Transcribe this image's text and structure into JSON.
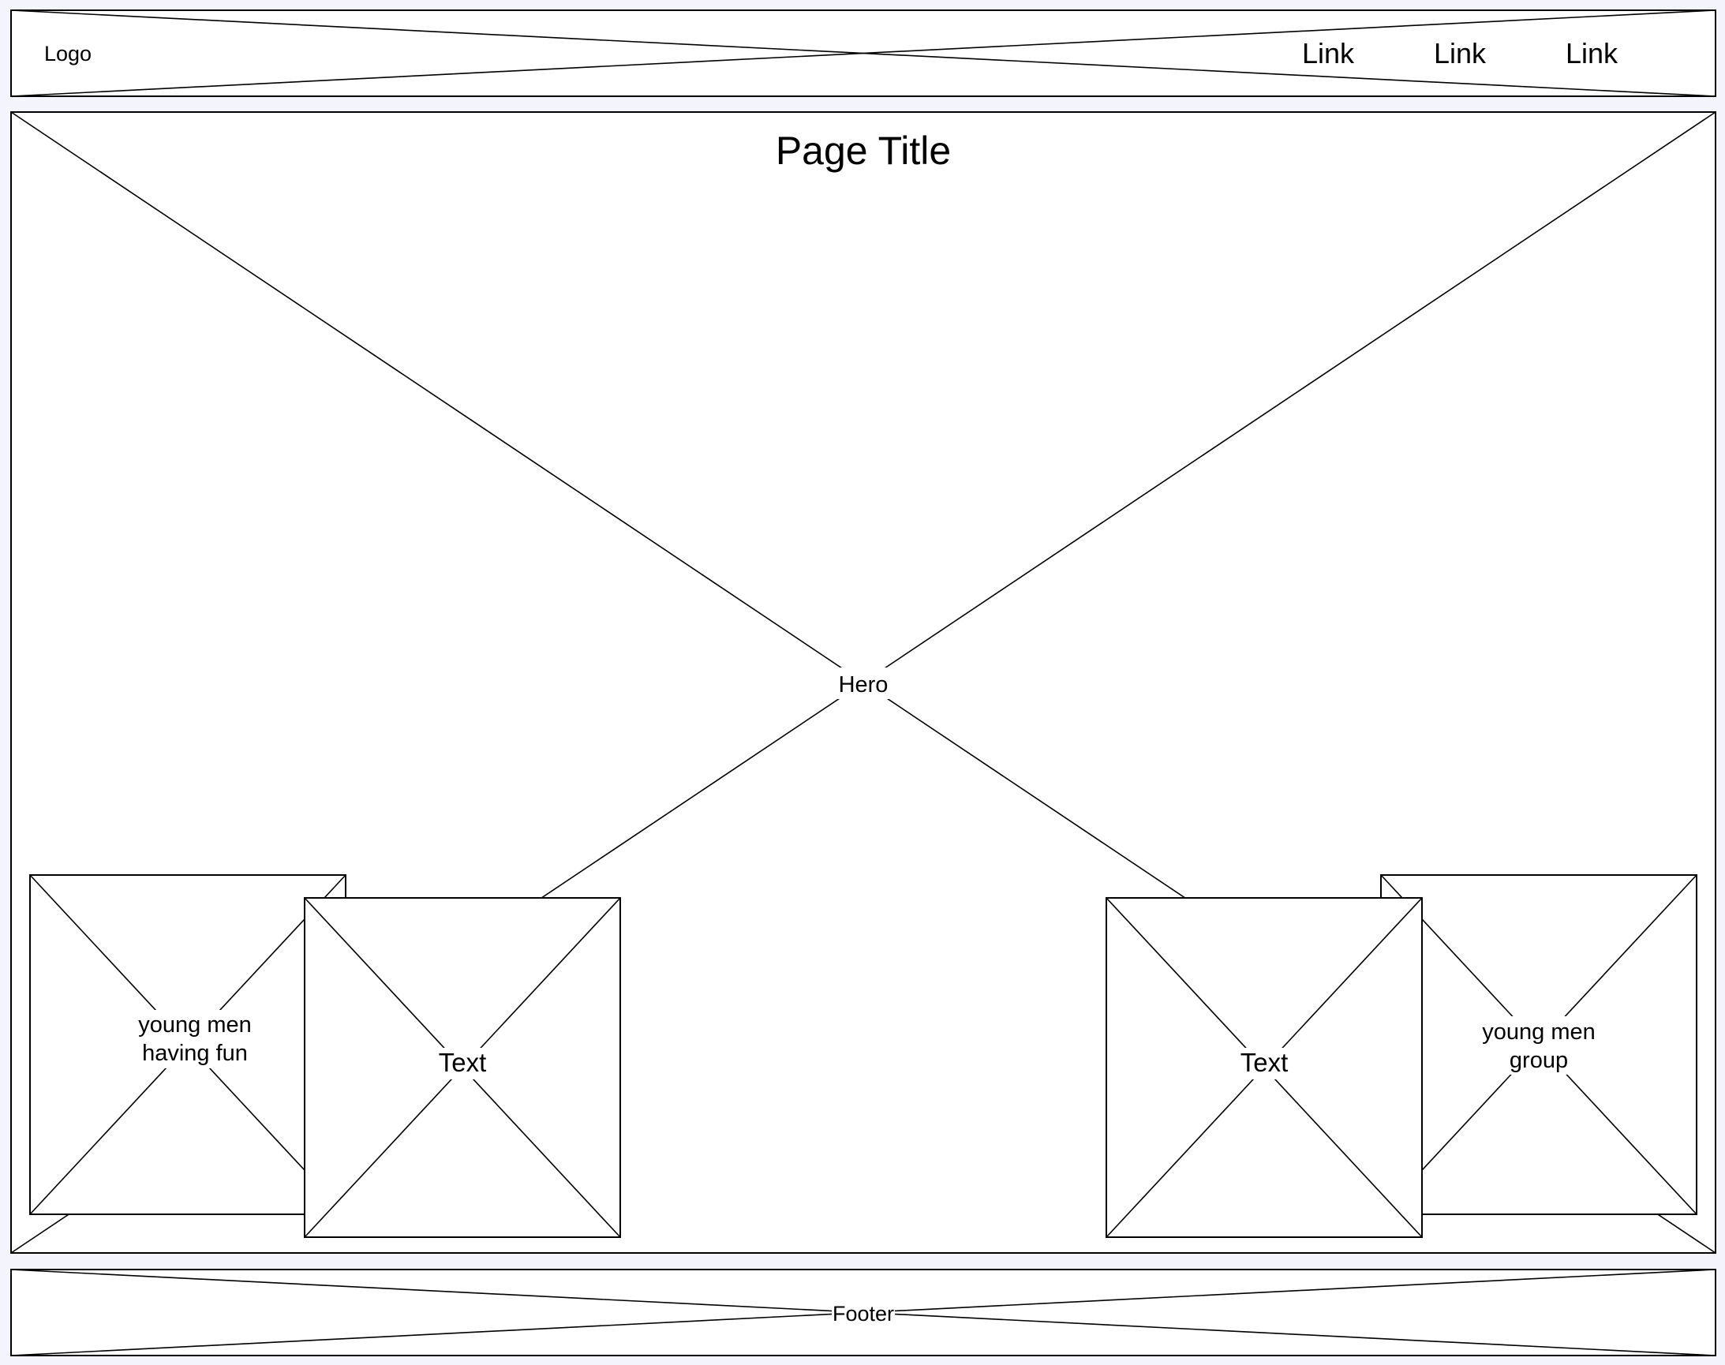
{
  "header": {
    "logo": "Logo",
    "nav_links": [
      "Link",
      "Link",
      "Link"
    ]
  },
  "main": {
    "page_title": "Page Title",
    "hero_label": "Hero",
    "cards": {
      "left_back": {
        "lines": [
          "young men",
          "having fun"
        ]
      },
      "left_front": {
        "lines": [
          "Text"
        ]
      },
      "right_front": {
        "lines": [
          "Text"
        ]
      },
      "right_back": {
        "lines": [
          "young men",
          "group"
        ]
      }
    }
  },
  "footer": {
    "label": "Footer"
  },
  "colors": {
    "background": "#f4f4fc",
    "fill": "#ffffff",
    "stroke": "#000000"
  }
}
